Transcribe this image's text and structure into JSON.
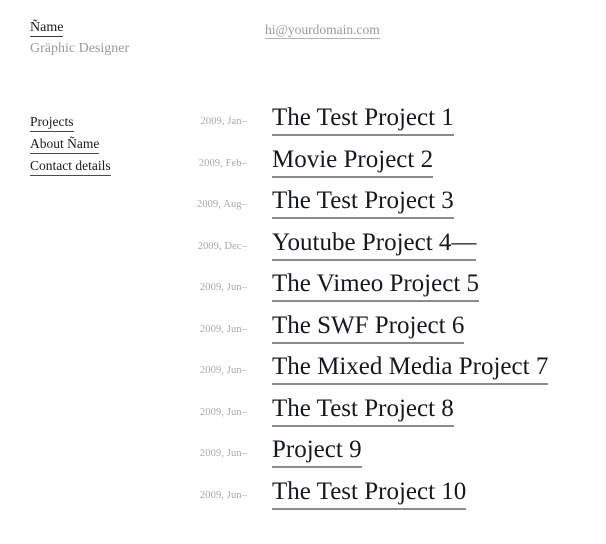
{
  "header": {
    "owner_name": "Ñame",
    "owner_role": "Gräphic Designer",
    "email": "hi@yourdomain.com"
  },
  "nav": {
    "items": [
      {
        "label": "Projects"
      },
      {
        "label": "About Ñame"
      },
      {
        "label": "Contact details"
      }
    ]
  },
  "projects": {
    "items": [
      {
        "date": "2009, Jan–",
        "title": "The Test Project 1"
      },
      {
        "date": "2009, Feb–",
        "title": "Movie Project 2"
      },
      {
        "date": "2009, Aug–",
        "title": "The Test Project 3"
      },
      {
        "date": "2009, Dec–",
        "title": "Youtube Project 4—"
      },
      {
        "date": "2009, Jun–",
        "title": "The Vimeo Project 5"
      },
      {
        "date": "2009, Jun–",
        "title": "The SWF Project 6"
      },
      {
        "date": "2009, Jun–",
        "title": "The Mixed Media Project 7"
      },
      {
        "date": "2009, Jun–",
        "title": "The Test Project 8"
      },
      {
        "date": "2009, Jun–",
        "title": "Project 9"
      },
      {
        "date": "2009, Jun–",
        "title": "The Test Project 10"
      }
    ]
  },
  "colors": {
    "background": "#ffffff",
    "text": "#15181c",
    "muted": "#a9a9a9",
    "rule": "#8c8c8c"
  }
}
